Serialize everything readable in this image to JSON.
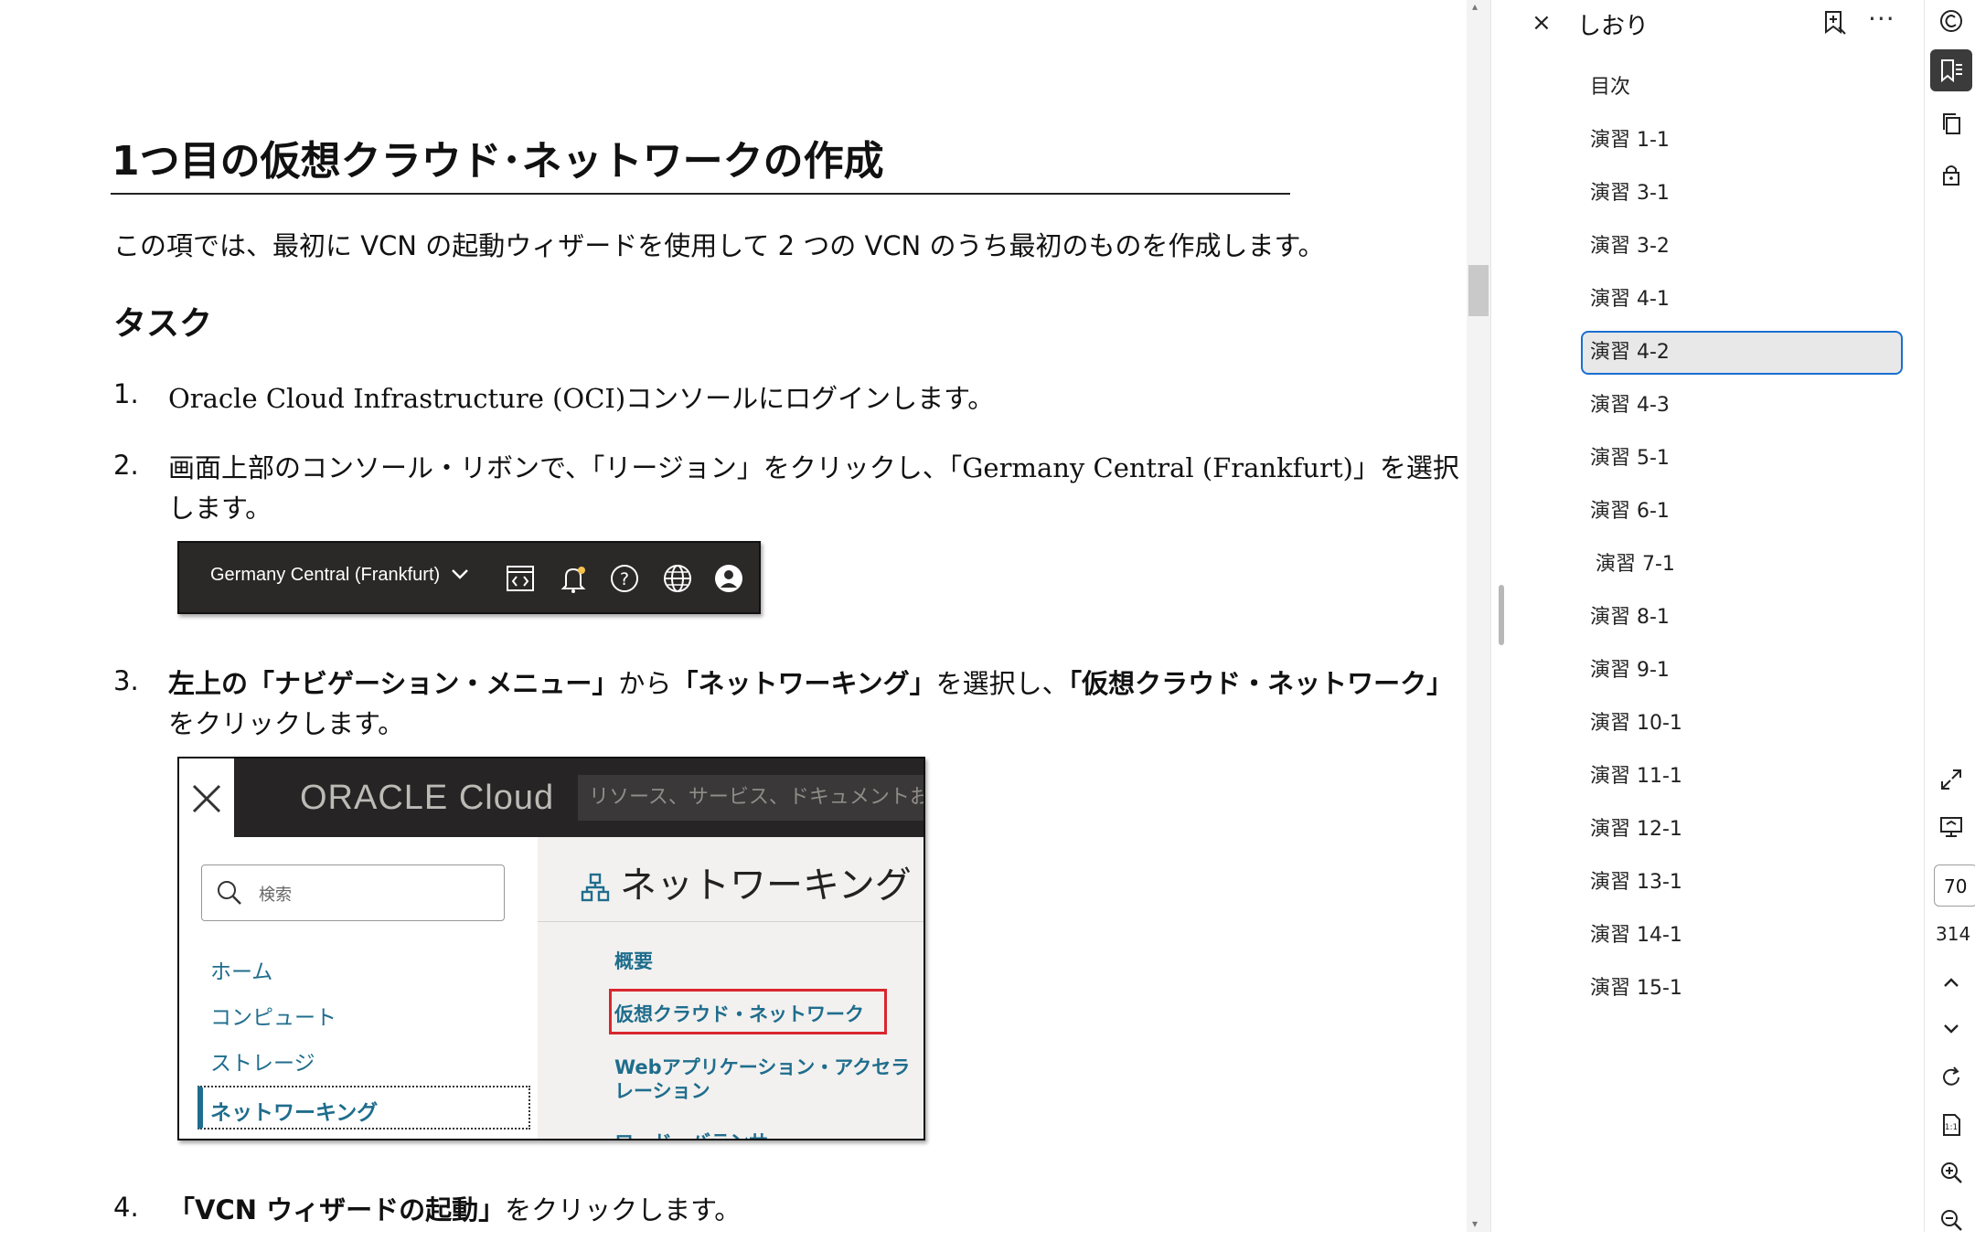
{
  "document": {
    "title": "1つ目の仮想クラウド･ネットワークの作成",
    "intro": "この項では、最初に VCN の起動ウィザードを使用して 2 つの VCN のうち最初のものを作成します。",
    "task_heading": "タスク",
    "steps": [
      {
        "num": "1.",
        "text": "Oracle Cloud Infrastructure (OCI)コンソールにログインします。"
      },
      {
        "num": "2.",
        "line1": "画面上部のコンソール・リボンで、「リージョン」をクリックし、「Germany Central (Frankfurt)」を選択",
        "line2": "します。"
      },
      {
        "num": "3.",
        "line1_parts": [
          "左上の「ナビゲーション・メニュー」",
          "から",
          "「ネットワーキング」",
          "を選択し、",
          "「仮想クラウド・ネットワーク」"
        ],
        "line2": "をクリックします。"
      },
      {
        "num": "4.",
        "parts": [
          "「VCN ウィザードの起動」",
          "をクリックします。"
        ]
      }
    ],
    "ribbon_image": {
      "region": "Germany Central (Frankfurt)",
      "icons": [
        "code-editor-icon",
        "bell-icon",
        "help-icon",
        "globe-icon",
        "profile-icon"
      ]
    },
    "nav_image": {
      "logo": "ORACLE Cloud",
      "top_search_placeholder": "リソース、サービス、ドキュメントおよびマ",
      "search_placeholder": "検索",
      "left_links": [
        "ホーム",
        "コンピュート",
        "ストレージ",
        "ネットワーキング"
      ],
      "heading": "ネットワーキング",
      "right_links": [
        "概要",
        "仮想クラウド・ネットワーク",
        "Webアプリケーション・アクセラ",
        "レーション",
        "ロード・バランサ"
      ]
    }
  },
  "panel": {
    "close": "×",
    "title": "しおり",
    "more": "···",
    "bookmarks": [
      "目次",
      "演習 1-1",
      "演習 3-1",
      "演習 3-2",
      "演習 4-1",
      "演習 4-2",
      "演習 4-3",
      "演習 5-1",
      "演習 6-1",
      "演習 7-1",
      "演習 8-1",
      "演習 9-1",
      "演習 10-1",
      "演習 11-1",
      "演習 12-1",
      "演習 13-1",
      "演習 14-1",
      "演習 15-1"
    ],
    "selected": "演習 4-2"
  },
  "rail": {
    "current_page": "70",
    "total_pages": "314"
  },
  "colors": {
    "selection_border": "#1a6fd0",
    "link": "#1f6d8d",
    "highlight": "#d9262e"
  }
}
